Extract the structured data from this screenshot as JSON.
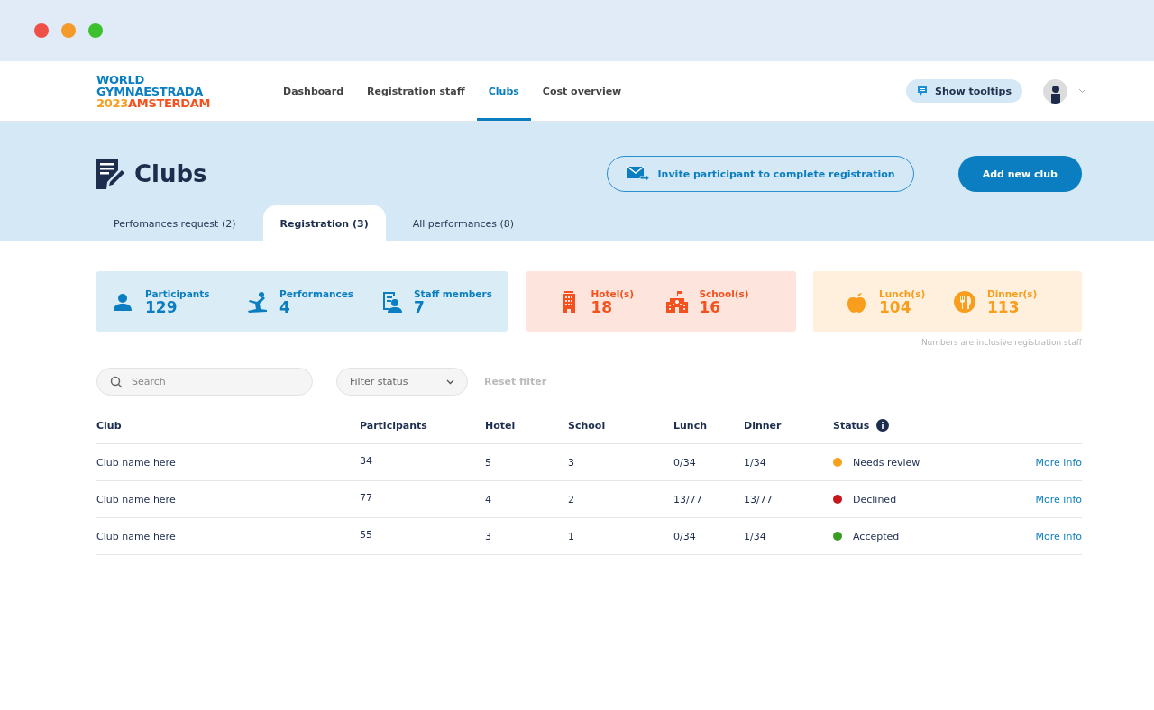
{
  "window": {
    "traffic_lights": [
      {
        "color": "#ee5048"
      },
      {
        "color": "#f39a2b"
      },
      {
        "color": "#3cc12d"
      }
    ]
  },
  "nav": {
    "logo": {
      "line_1": "WORLD",
      "line_2": "GYMNAESTRADA",
      "line_3a": "2023",
      "line_3b": "AMSTERDAM"
    },
    "items": [
      {
        "label": "Dashboard",
        "selected": false
      },
      {
        "label": "Registration staff",
        "selected": false
      },
      {
        "label": "Clubs",
        "selected": true
      },
      {
        "label": "Cost overview",
        "selected": false
      }
    ],
    "tooltip_button": "Show tooltips"
  },
  "header": {
    "title": "Clubs",
    "invite_button": "Invite participant to complete registration",
    "add_button": "Add new club",
    "tabs": [
      {
        "label": "Perfomances request (2)",
        "selected": false
      },
      {
        "label": "Registration (3)",
        "selected": true
      },
      {
        "label": "All performances (8)",
        "selected": false
      }
    ]
  },
  "stats": {
    "groups": [
      {
        "color": "#0a7ec0",
        "items": [
          {
            "kind": "person",
            "label": "Participants",
            "value": "129"
          },
          {
            "kind": "gymnast",
            "label": "Performances",
            "value": "4"
          },
          {
            "kind": "staff",
            "label": "Staff members",
            "value": "7"
          }
        ]
      },
      {
        "color": "#f4511e",
        "items": [
          {
            "kind": "hotel",
            "label": "Hotel(s)",
            "value": "18"
          },
          {
            "kind": "school",
            "label": "School(s)",
            "value": "16"
          }
        ]
      },
      {
        "color": "#f99d1c",
        "items": [
          {
            "kind": "apple",
            "label": "Lunch(s)",
            "value": "104"
          },
          {
            "kind": "dinner",
            "label": "Dinner(s)",
            "value": "113"
          }
        ]
      }
    ],
    "note": "Numbers are inclusive registration staff"
  },
  "filters": {
    "search_placeholder": "Search",
    "status_placeholder": "Filter status",
    "reset": "Reset filter"
  },
  "table": {
    "columns": [
      "Club",
      "Participants",
      "Hotel",
      "School",
      "Lunch",
      "Dinner",
      "Status"
    ],
    "rows": [
      {
        "club": "Club name here",
        "participants": "34",
        "hotel": "5",
        "school": "3",
        "lunch": "0/34",
        "dinner": "1/34",
        "status": "Needs review",
        "color": "#f7a21e",
        "link": "More info"
      },
      {
        "club": "Club name here",
        "participants": "77",
        "hotel": "4",
        "school": "2",
        "lunch": "13/77",
        "dinner": "13/77",
        "status": "Declined",
        "color": "#c8161d",
        "link": "More info"
      },
      {
        "club": "Club name here",
        "participants": "55",
        "hotel": "3",
        "school": "1",
        "lunch": "0/34",
        "dinner": "1/34",
        "status": "Accepted",
        "color": "#3a9b23",
        "link": "More info"
      }
    ]
  }
}
